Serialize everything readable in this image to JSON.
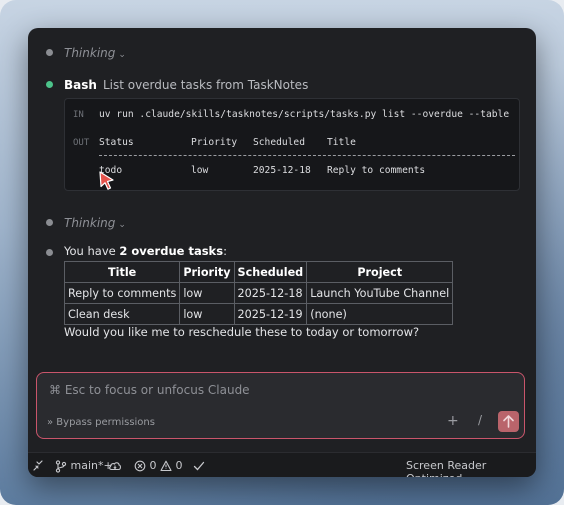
{
  "thinking_1": {
    "label": "Thinking",
    "chevron": "⌄"
  },
  "bash": {
    "name": "Bash",
    "description": "List overdue tasks from TaskNotes",
    "in_tag": "IN",
    "out_tag": "OUT",
    "command": "uv run .claude/skills/tasknotes/scripts/tasks.py list --overdue --table",
    "output": {
      "headers": [
        "Status",
        "Priority",
        "Scheduled",
        "Title"
      ],
      "row": [
        "todo",
        "low",
        "2025-12-18",
        "Reply to comments"
      ]
    }
  },
  "thinking_2": {
    "label": "Thinking",
    "chevron": "⌄"
  },
  "answer": {
    "intro_prefix": "You have ",
    "intro_bold": "2 overdue tasks",
    "intro_suffix": ":",
    "table": {
      "headers": [
        "Title",
        "Priority",
        "Scheduled",
        "Project"
      ],
      "rows": [
        [
          "Reply to comments",
          "low",
          "2025-12-18",
          "Launch YouTube Channel"
        ],
        [
          "Clean desk",
          "low",
          "2025-12-19",
          "(none)"
        ]
      ]
    },
    "followup": "Would you like me to reschedule these to today or tomorrow?"
  },
  "input": {
    "placeholder": "⌘ Esc to focus or unfocus Claude",
    "bypass": "» Bypass permissions",
    "plus": "+",
    "slash": "/"
  },
  "status_bar": {
    "branch": "main*+",
    "errors": "0",
    "warnings": "0",
    "screen_reader": "Screen Reader Optimized"
  },
  "colors": {
    "accent": "#c9556b",
    "success_dot": "#4cc38a",
    "panel": "#1f2023"
  }
}
